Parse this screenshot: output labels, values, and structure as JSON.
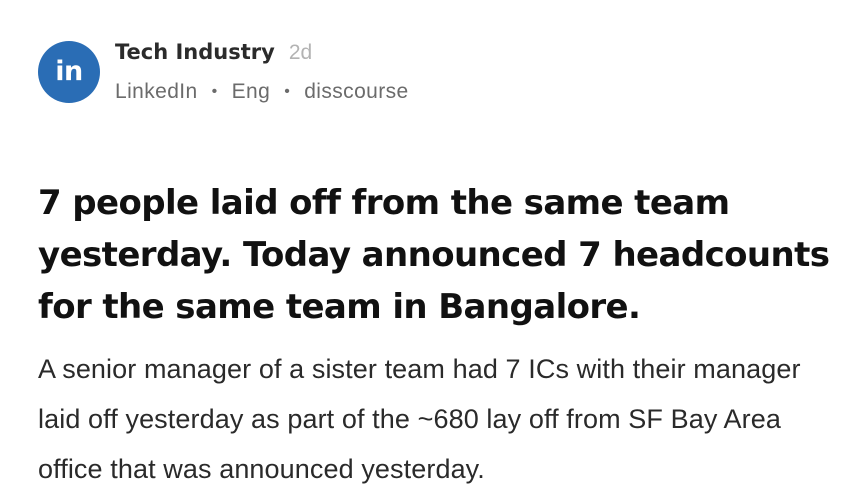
{
  "post": {
    "avatar_text": "in",
    "community": "Tech Industry",
    "time": "2d",
    "meta": {
      "company": "LinkedIn",
      "separator": "•",
      "language": "Eng",
      "author": "disscourse"
    },
    "title": "7 people laid off from the same team yesterday. Today announced 7 headcounts for the same team in Bangalore.",
    "body": "A senior manager of a sister team had 7 ICs with their manager laid off yesterday as part of the ~680 lay off from SF Bay Area office that was announced yesterday."
  },
  "colors": {
    "avatar_bg": "#2a6db5",
    "title_text": "#111111",
    "meta_text": "#6b6b6b",
    "time_text": "#b3b3b3"
  }
}
